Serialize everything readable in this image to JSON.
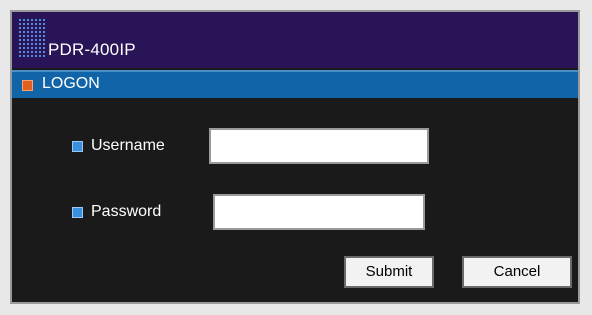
{
  "app": {
    "title": "PDR-400IP"
  },
  "section": {
    "title": "LOGON"
  },
  "form": {
    "username_label": "Username",
    "username_value": "",
    "password_label": "Password",
    "password_value": "",
    "submit_label": "Submit",
    "cancel_label": "Cancel"
  },
  "colors": {
    "title_bar": "#2a1458",
    "section_bar": "#1164a8",
    "body": "#1a1a1a",
    "section_bullet": "#e06020",
    "field_bullet": "#3a8fe0"
  }
}
